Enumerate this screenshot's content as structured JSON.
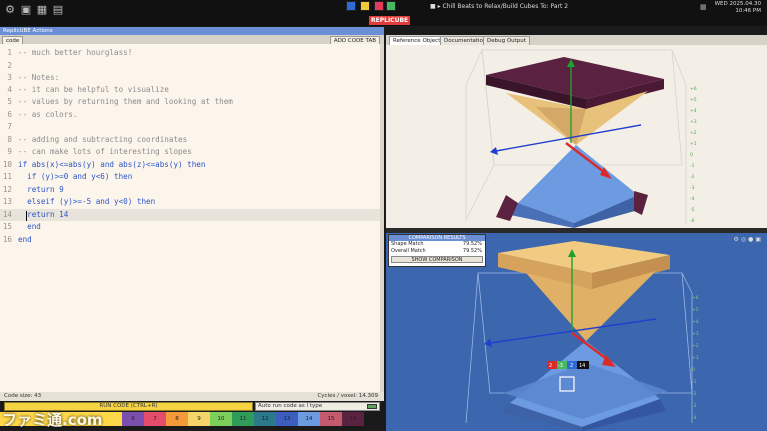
{
  "topbar": {
    "app_title": "REPLICUBE",
    "music": "Chill Beats to Relax/Build Cubes To: Part 2",
    "clock_date": "WED 2025.04.30",
    "clock_time": "10:46 PM"
  },
  "window_title": "ReplicUBE Actions",
  "editor": {
    "tabs": {
      "code": "code",
      "add_code_tab": "ADD CODE TAB"
    },
    "lines": [
      {
        "n": "1",
        "t": "-- much better hourglass!"
      },
      {
        "n": "2",
        "t": ""
      },
      {
        "n": "3",
        "t": "-- Notes:"
      },
      {
        "n": "4",
        "t": "-- it can be helpful to visualize"
      },
      {
        "n": "5",
        "t": "-- values by returning them and looking at them"
      },
      {
        "n": "6",
        "t": "-- as colors."
      },
      {
        "n": "7",
        "t": ""
      },
      {
        "n": "8",
        "t": "-- adding and subtracting coordinates"
      },
      {
        "n": "9",
        "t": "-- can make lots of interesting slopes"
      },
      {
        "n": "10",
        "t": "if abs(x)<=abs(y) and abs(z)<=abs(y) then"
      },
      {
        "n": "11",
        "t": "  if (y)>=0 and y<6) then"
      },
      {
        "n": "12",
        "t": "  return 9"
      },
      {
        "n": "13",
        "t": "  elseif (y)>=-5 and y<0) then"
      },
      {
        "n": "14",
        "t": "  return 14"
      },
      {
        "n": "15",
        "t": "  end"
      },
      {
        "n": "16",
        "t": "end"
      }
    ]
  },
  "status": {
    "code_size": "Code size: 43",
    "cycles": "Cycles / voxel: 14.309"
  },
  "run_button": "RUN CODE (CTRL+R)",
  "auto_run": "Auto run code as I type",
  "palette": [
    {
      "label": "",
      "color": "#ffd84a"
    },
    {
      "label": "1",
      "color": "#f6d343"
    },
    {
      "label": "2",
      "color": "#f2c93a"
    },
    {
      "label": "3",
      "color": "#f2c93a"
    },
    {
      "label": "4",
      "color": "#f2c93a"
    },
    {
      "label": "5",
      "color": "#f2c93a"
    },
    {
      "label": "6",
      "color": "#7b4fae"
    },
    {
      "label": "7",
      "color": "#e44c6c"
    },
    {
      "label": "8",
      "color": "#f39a3a"
    },
    {
      "label": "9",
      "color": "#f5d46a"
    },
    {
      "label": "10",
      "color": "#7ccf5a"
    },
    {
      "label": "11",
      "color": "#2f9c5a"
    },
    {
      "label": "12",
      "color": "#2a7a8c"
    },
    {
      "label": "13",
      "color": "#3c5fbf"
    },
    {
      "label": "14",
      "color": "#6c9be2"
    },
    {
      "label": "15",
      "color": "#c45a6e"
    },
    {
      "label": "16",
      "color": "#5a2240"
    }
  ],
  "ref_tabs": {
    "reference": "Reference Object",
    "docs": "Documentation",
    "debug": "Debug Output"
  },
  "comparison": {
    "title": "COMPARISON RESULTS",
    "shape_label": "Shape Match",
    "shape_value": "79.52%",
    "overall_label": "Overall Match",
    "overall_value": "79.52%",
    "button": "SHOW COMPARISON"
  },
  "labels": {
    "voxel_labels": [
      "2",
      "-3",
      "2",
      "14"
    ],
    "axis_ticks": [
      "+6",
      "+5",
      "+4",
      "+3",
      "+2",
      "+1",
      "0",
      "-1",
      "-2",
      "-3",
      "-4",
      "-5",
      "-6"
    ]
  },
  "watermark": "ファミ通.com"
}
